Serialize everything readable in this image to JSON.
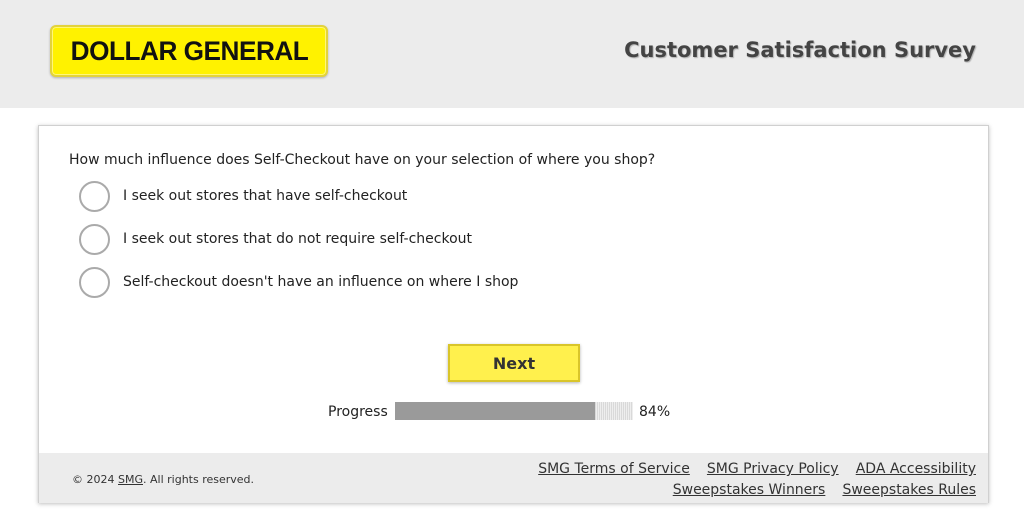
{
  "header": {
    "logo_text": "DOLLAR GENERAL",
    "title": "Customer Satisfaction Survey"
  },
  "question": {
    "text": "How much influence does Self-Checkout have on your selection of where you shop?",
    "options": [
      {
        "label": "I seek out stores that have self-checkout",
        "selected": false
      },
      {
        "label": "I seek out stores that do not require self-checkout",
        "selected": false
      },
      {
        "label": "Self-checkout doesn't have an influence on where I shop",
        "selected": false
      }
    ]
  },
  "next_label": "Next",
  "progress": {
    "label": "Progress",
    "value_text": "84%",
    "fraction": 0.84
  },
  "footer": {
    "copyright_prefix": "© 2024 ",
    "copyright_link": "SMG",
    "copyright_suffix": ". All rights reserved.",
    "links": [
      "SMG Terms of Service",
      "SMG Privacy Policy",
      "ADA Accessibility",
      "Sweepstakes Winners",
      "Sweepstakes Rules"
    ]
  },
  "colors": {
    "brand_yellow": "#fff200",
    "button_yellow": "#fff04d",
    "header_bg": "#ececec",
    "progress_fill": "#9a9a9a"
  }
}
